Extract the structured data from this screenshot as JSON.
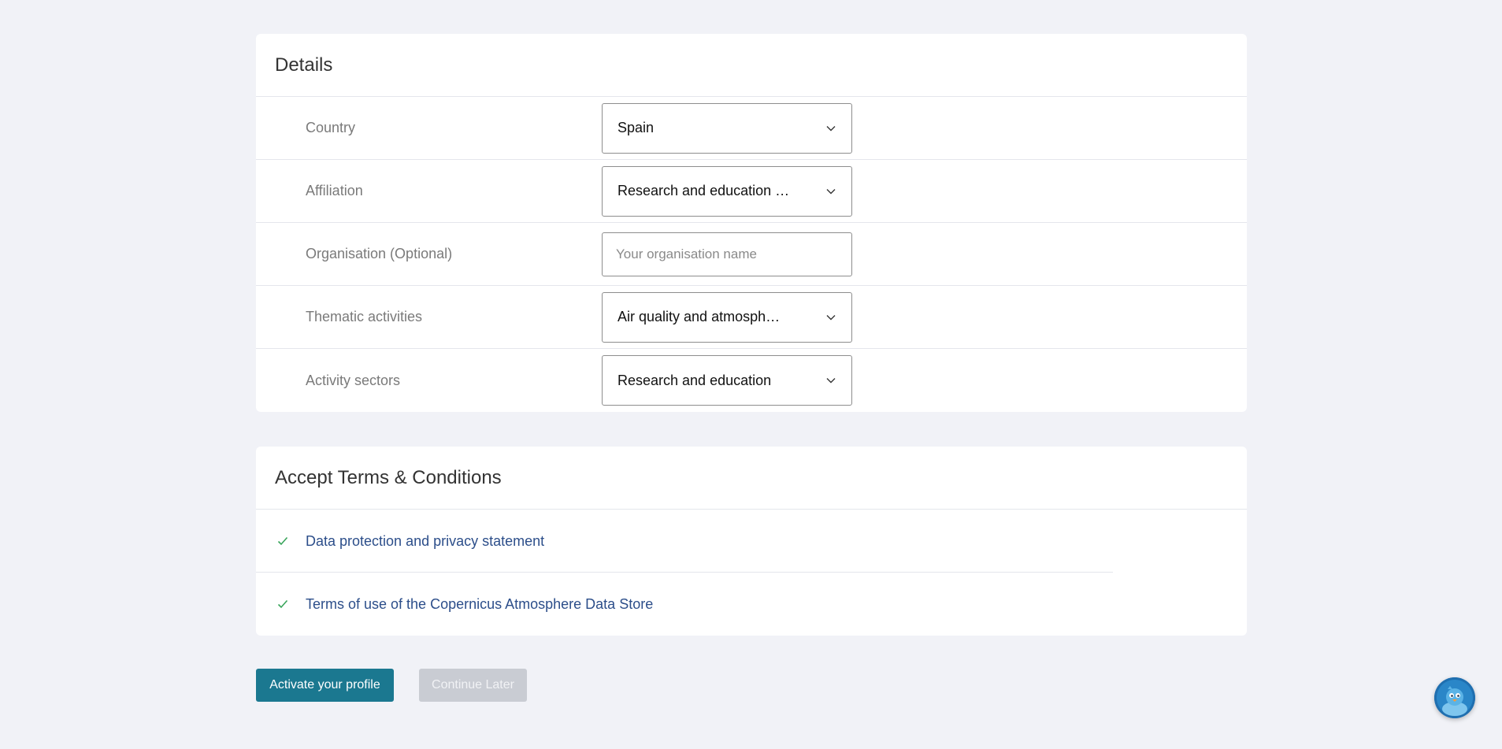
{
  "details": {
    "title": "Details",
    "rows": [
      {
        "label": "Country",
        "value": "Spain"
      },
      {
        "label": "Affiliation",
        "value": "Research and education …"
      },
      {
        "label": "Organisation (Optional)",
        "placeholder": "Your organisation name"
      },
      {
        "label": "Thematic activities",
        "value": "Air quality and atmosph…"
      },
      {
        "label": "Activity sectors",
        "value": "Research and education"
      }
    ]
  },
  "terms": {
    "title": "Accept Terms & Conditions",
    "items": [
      {
        "label": "Data protection and privacy statement",
        "accepted": true
      },
      {
        "label": "Terms of use of the Copernicus Atmosphere Data Store",
        "accepted": true
      }
    ]
  },
  "actions": {
    "activate_label": "Activate your profile",
    "continue_label": "Continue Later"
  },
  "icons": {
    "select_chevron": "chevron-down-icon",
    "accepted": "checkmark-icon",
    "chat": "chatbot-avatar-icon"
  },
  "colors": {
    "primary": "#1b7890",
    "link": "#2c4e8a",
    "check": "#3aa55c",
    "disabled": "#c9ccd3"
  }
}
